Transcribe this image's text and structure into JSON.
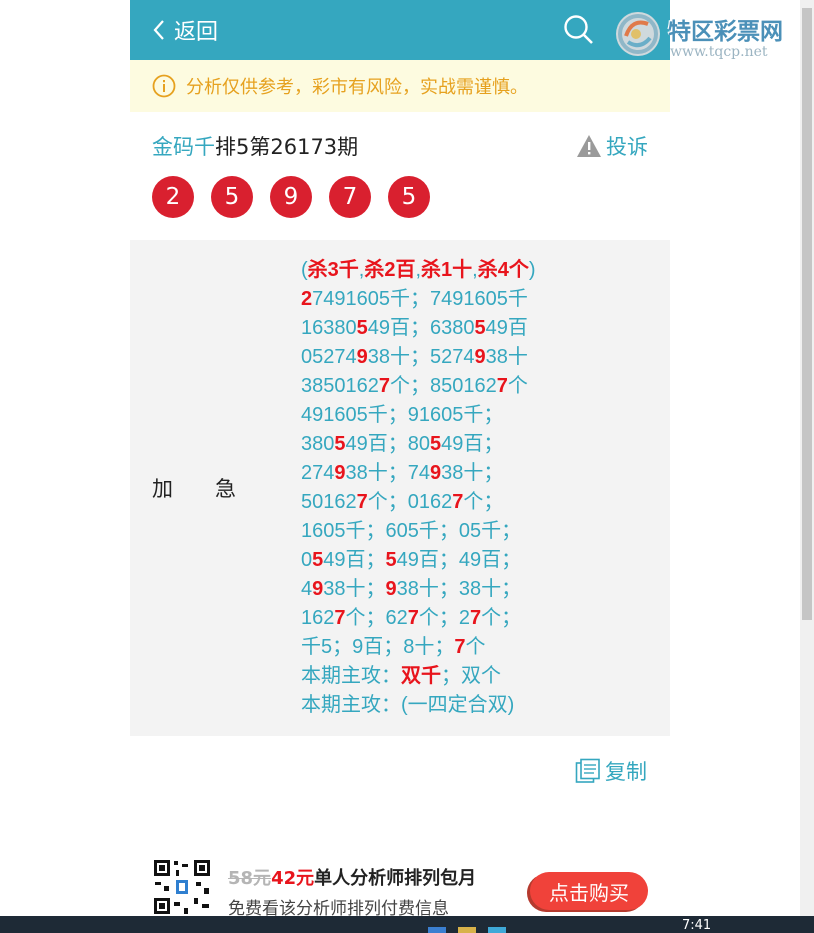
{
  "header": {
    "back_label": "返回"
  },
  "watermark": {
    "name": "特区彩票网",
    "url": "www.tqcp.net"
  },
  "notice": {
    "text": "分析仅供参考，彩市有风险，实战需谨慎。"
  },
  "article": {
    "author": "金码千",
    "title_rest": "排5第26173期",
    "complaint_label": "投诉",
    "numbers": [
      "2",
      "5",
      "9",
      "7",
      "5"
    ]
  },
  "panel": {
    "label_1": "加",
    "label_2": "急",
    "lines": [
      [
        [
          "(",
          ""
        ],
        [
          "杀3千",
          "r"
        ],
        [
          ",",
          ""
        ],
        [
          "杀2百",
          "r"
        ],
        [
          ",",
          ""
        ],
        [
          "杀1十",
          "r"
        ],
        [
          ",",
          ""
        ],
        [
          "杀4个",
          "r"
        ],
        [
          ")",
          ""
        ]
      ],
      [
        [
          "2",
          "r"
        ],
        [
          "7491605千；7491605千",
          ""
        ]
      ],
      [
        [
          "16380",
          ""
        ],
        [
          "5",
          "r"
        ],
        [
          "49百；6380",
          ""
        ],
        [
          "5",
          "r"
        ],
        [
          "49百",
          ""
        ]
      ],
      [
        [
          "05274",
          ""
        ],
        [
          "9",
          "r"
        ],
        [
          "38十；5274",
          ""
        ],
        [
          "9",
          "r"
        ],
        [
          "38十",
          ""
        ]
      ],
      [
        [
          "385016",
          ""
        ],
        [
          "2",
          ""
        ],
        [
          "7",
          "r"
        ],
        [
          "个；850162",
          ""
        ],
        [
          "7",
          "r"
        ],
        [
          "个",
          ""
        ]
      ],
      [
        [
          "491605千；91605千；",
          ""
        ]
      ],
      [
        [
          "380",
          ""
        ],
        [
          "5",
          "r"
        ],
        [
          "49百；80",
          ""
        ],
        [
          "5",
          "r"
        ],
        [
          "49百；",
          ""
        ]
      ],
      [
        [
          "274",
          ""
        ],
        [
          "9",
          "r"
        ],
        [
          "38十；74",
          ""
        ],
        [
          "9",
          "r"
        ],
        [
          "38十；",
          ""
        ]
      ],
      [
        [
          "5016",
          ""
        ],
        [
          "2",
          ""
        ],
        [
          "7",
          "r"
        ],
        [
          "个；0162",
          ""
        ],
        [
          "7",
          "r"
        ],
        [
          "个；",
          ""
        ]
      ],
      [
        [
          "1605千；605千；05千；",
          ""
        ]
      ],
      [
        [
          "0",
          ""
        ],
        [
          "5",
          "r"
        ],
        [
          "49百；",
          ""
        ],
        [
          "5",
          "r"
        ],
        [
          "49百；49百；",
          ""
        ]
      ],
      [
        [
          "4",
          ""
        ],
        [
          "9",
          "r"
        ],
        [
          "38十；",
          ""
        ],
        [
          "9",
          "r"
        ],
        [
          "38十；38十；",
          ""
        ]
      ],
      [
        [
          "162",
          ""
        ],
        [
          "7",
          "r"
        ],
        [
          "个；62",
          ""
        ],
        [
          "7",
          "r"
        ],
        [
          "个；2",
          ""
        ],
        [
          "7",
          "r"
        ],
        [
          "个；",
          ""
        ]
      ],
      [
        [
          "千5；9百；8十；",
          ""
        ],
        [
          "7",
          "r"
        ],
        [
          "个",
          ""
        ]
      ],
      [
        [
          "本期主攻：",
          ""
        ],
        [
          "双千",
          "r"
        ],
        [
          "；双个",
          ""
        ]
      ],
      [
        [
          "本期主攻：(一四定合双)",
          ""
        ]
      ]
    ]
  },
  "copy": {
    "label": "复制"
  },
  "ad": {
    "old_price": "58元",
    "new_price": "42元",
    "title": "单人分析师排列包月",
    "subtitle": "免费看该分析师排列付费信息",
    "buy_label": "点击购买"
  },
  "taskbar": {
    "time": "7:41"
  },
  "colors": {
    "accent": "#35a7bf",
    "ball": "#d9202f",
    "highlight": "#e8141c",
    "notice_bg": "#fdfbe0",
    "buy": "#f0423a"
  }
}
